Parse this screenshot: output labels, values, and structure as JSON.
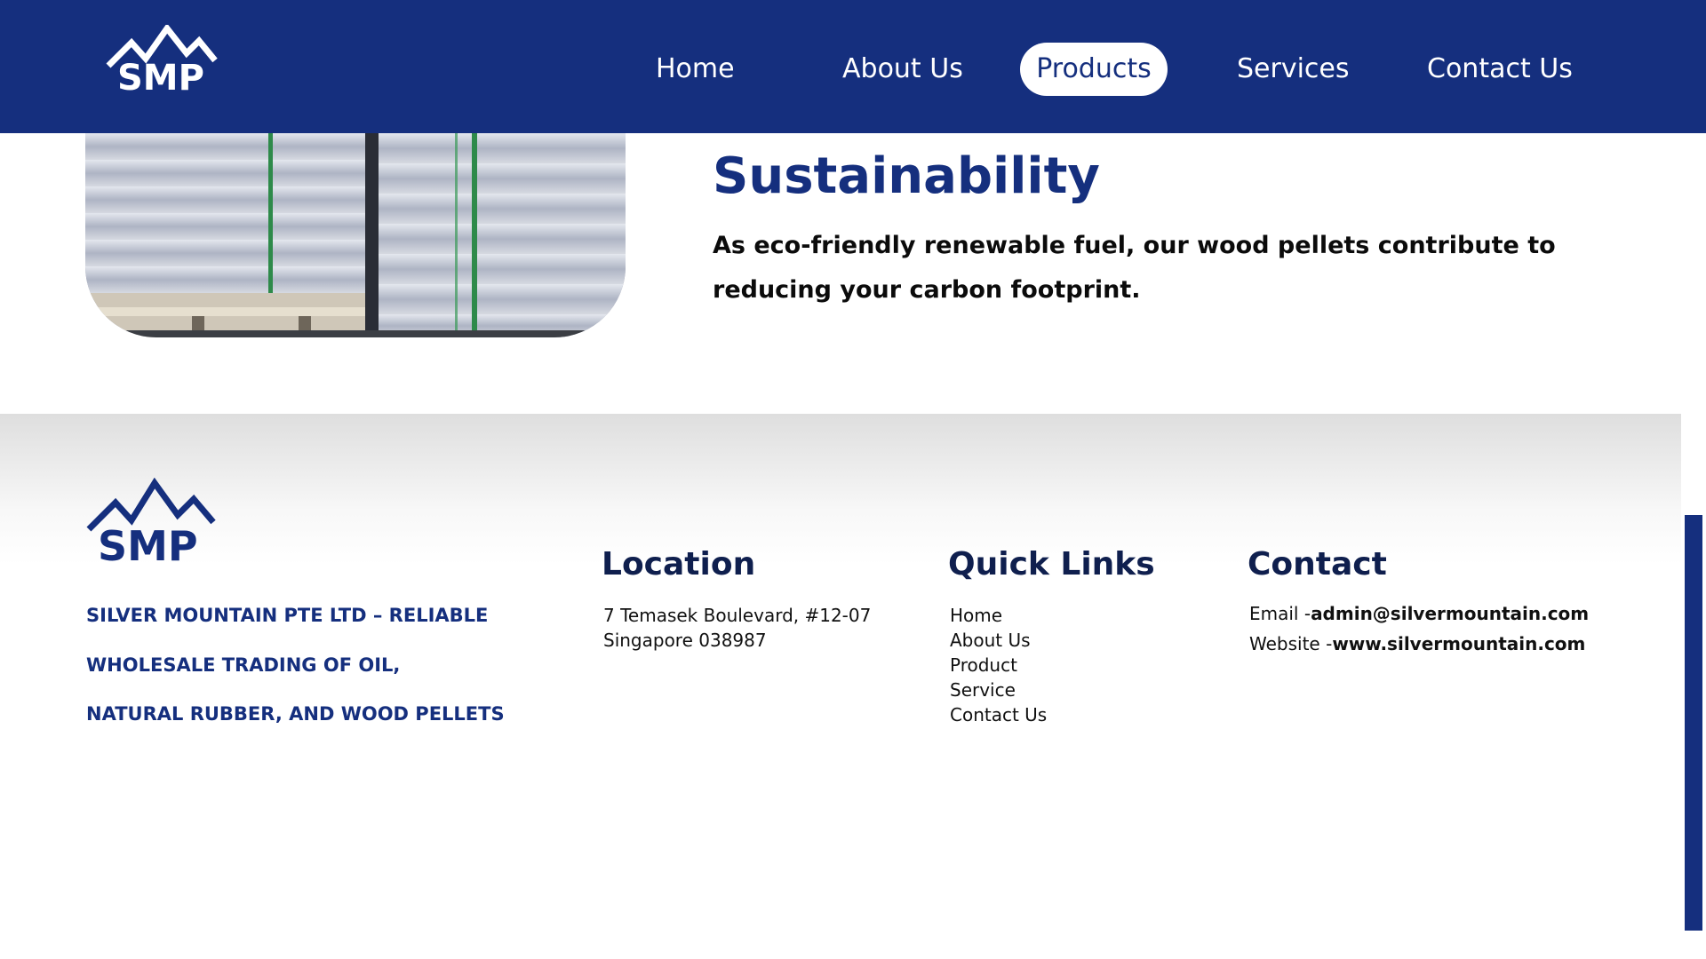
{
  "header": {
    "logo_text": "SMP",
    "nav": [
      {
        "label": "Home",
        "active": false
      },
      {
        "label": "About Us",
        "active": false
      },
      {
        "label": "Products",
        "active": true
      },
      {
        "label": "Services",
        "active": false
      },
      {
        "label": "Contact Us",
        "active": false
      }
    ]
  },
  "section": {
    "title": "Sustainability",
    "text": "As eco-friendly renewable fuel, our wood pellets contribute to reducing your carbon footprint.",
    "image_subject": "stacked wood pellet bags on pallets"
  },
  "footer": {
    "logo_text": "SMP",
    "tagline_lines": [
      "SILVER MOUNTAIN PTE LTD – RELIABLE",
      "WHOLESALE TRADING OF OIL,",
      "NATURAL RUBBER, AND WOOD PELLETS"
    ],
    "location": {
      "title": "Location",
      "lines": [
        "7 Temasek Boulevard, #12-07",
        "Singapore 038987"
      ]
    },
    "quick_links": {
      "title": "Quick Links",
      "items": [
        "Home",
        "About Us",
        "Product",
        "Service",
        "Contact Us"
      ]
    },
    "contact": {
      "title": "Contact",
      "email_label": "Email -",
      "email_value": "admin@silvermountain.com",
      "website_label": "Website -",
      "website_value": "www.silvermountain.com"
    }
  },
  "colors": {
    "brand": "#152f7e",
    "text_dark": "#0f1f4e",
    "white": "#ffffff"
  }
}
